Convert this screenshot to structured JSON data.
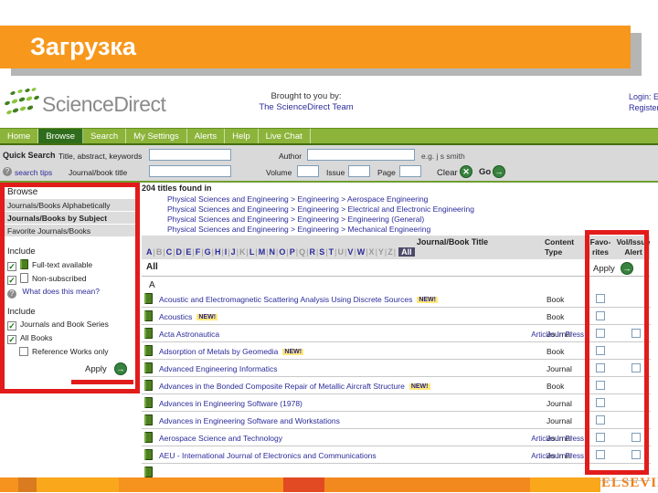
{
  "slide": {
    "title": "Загрузка"
  },
  "colors": {
    "accent_orange": "#F7981D",
    "nav_green": "#8CB43A",
    "active_tab_green": "#2F6D1C",
    "annotation_red": "#E21B1B",
    "link_blue": "#2B2B9B",
    "elsevier_orange": "#EF7F1A"
  },
  "header": {
    "logo_text": "ScienceDirect",
    "brought_line1": "Brought to you by:",
    "brought_line2": "The ScienceDirect Team",
    "login": "Login: E",
    "register": "Register"
  },
  "nav": {
    "items": [
      {
        "label": "Home",
        "active": false
      },
      {
        "label": "Browse",
        "active": true
      },
      {
        "label": "Search",
        "active": false
      },
      {
        "label": "My Settings",
        "active": false
      },
      {
        "label": "Alerts",
        "active": false
      },
      {
        "label": "Help",
        "active": false
      },
      {
        "label": "Live Chat",
        "active": false
      }
    ]
  },
  "quick_search": {
    "title": "Quick Search",
    "field1_label": "Title, abstract, keywords",
    "author_label": "Author",
    "hint": "e.g. j s smith",
    "tips_label": "search tips",
    "journal_label": "Journal/book title",
    "volume_label": "Volume",
    "issue_label": "Issue",
    "page_label": "Page",
    "clear_label": "Clear",
    "go_label": "Go"
  },
  "sidebar": {
    "header": "Browse",
    "items": [
      {
        "label": "Journals/Books Alphabetically",
        "selected": false
      },
      {
        "label": "Journals/Books by Subject",
        "selected": true
      },
      {
        "label": "Favorite Journals/Books",
        "selected": false
      }
    ],
    "include_content": {
      "label": "Include",
      "options": [
        {
          "label": "Full-text available",
          "checked": true,
          "icon": "subscribed-book-icon"
        },
        {
          "label": "Non-subscribed",
          "checked": true,
          "icon": "non-subscribed-book-icon"
        }
      ],
      "help": "What does this mean?"
    },
    "include_types": {
      "label": "Include",
      "options": [
        {
          "label": "Journals and Book Series",
          "checked": true,
          "indent": false
        },
        {
          "label": "All Books",
          "checked": true,
          "indent": false
        },
        {
          "label": "Reference Works only",
          "checked": false,
          "indent": true
        }
      ],
      "apply_label": "Apply"
    }
  },
  "results": {
    "found": "204 titles found in",
    "categories": [
      "Physical Sciences and Engineering > Engineering > Aerospace Engineering",
      "Physical Sciences and Engineering > Engineering > Electrical and Electronic Engineering",
      "Physical Sciences and Engineering > Engineering > Engineering (General)",
      "Physical Sciences and Engineering > Engineering > Mechanical Engineering"
    ],
    "columns": {
      "title": "Journal/Book Title",
      "content_line1": "Content",
      "content_line2": "Type",
      "fav_line1": "Favo-",
      "fav_line2": "rites",
      "alert_line1": "Vol/Issue",
      "alert_line2": "Alert"
    },
    "alphabet": [
      {
        "letter": "A",
        "state": "active"
      },
      {
        "letter": "B",
        "state": "inactive"
      },
      {
        "letter": "C",
        "state": "active"
      },
      {
        "letter": "D",
        "state": "active"
      },
      {
        "letter": "E",
        "state": "active"
      },
      {
        "letter": "F",
        "state": "active"
      },
      {
        "letter": "G",
        "state": "active"
      },
      {
        "letter": "H",
        "state": "active"
      },
      {
        "letter": "I",
        "state": "active"
      },
      {
        "letter": "J",
        "state": "active"
      },
      {
        "letter": "K",
        "state": "inactive"
      },
      {
        "letter": "L",
        "state": "active"
      },
      {
        "letter": "M",
        "state": "active"
      },
      {
        "letter": "N",
        "state": "active"
      },
      {
        "letter": "O",
        "state": "active"
      },
      {
        "letter": "P",
        "state": "active"
      },
      {
        "letter": "Q",
        "state": "inactive"
      },
      {
        "letter": "R",
        "state": "active"
      },
      {
        "letter": "S",
        "state": "active"
      },
      {
        "letter": "T",
        "state": "active"
      },
      {
        "letter": "U",
        "state": "inactive"
      },
      {
        "letter": "V",
        "state": "active"
      },
      {
        "letter": "W",
        "state": "active"
      },
      {
        "letter": "X",
        "state": "inactive"
      },
      {
        "letter": "Y",
        "state": "inactive"
      },
      {
        "letter": "Z",
        "state": "inactive"
      },
      {
        "letter": "All",
        "state": "selected"
      }
    ],
    "filter_label": "All",
    "apply_label": "Apply",
    "section": "A",
    "new_badge": "NEW!",
    "articles_in_press": "Articles In Press",
    "rows": [
      {
        "title": "Acoustic and Electromagnetic Scattering Analysis Using Discrete Sources",
        "new": true,
        "type": "Book",
        "aip": false,
        "fav": true,
        "alert": false
      },
      {
        "title": "Acoustics",
        "new": true,
        "type": "Book",
        "aip": false,
        "fav": true,
        "alert": false
      },
      {
        "title": "Acta Astronautica",
        "new": false,
        "type": "Journal",
        "aip": true,
        "fav": true,
        "alert": true
      },
      {
        "title": "Adsorption of Metals by Geomedia",
        "new": true,
        "type": "Book",
        "aip": false,
        "fav": true,
        "alert": false
      },
      {
        "title": "Advanced Engineering Informatics",
        "new": false,
        "type": "Journal",
        "aip": false,
        "fav": true,
        "alert": true
      },
      {
        "title": "Advances in the Bonded Composite Repair of Metallic Aircraft Structure",
        "new": true,
        "type": "Book",
        "aip": false,
        "fav": true,
        "alert": false
      },
      {
        "title": "Advances in Engineering Software (1978)",
        "new": false,
        "type": "Journal",
        "aip": false,
        "fav": true,
        "alert": false
      },
      {
        "title": "Advances in Engineering Software and Workstations",
        "new": false,
        "type": "Journal",
        "aip": false,
        "fav": true,
        "alert": false
      },
      {
        "title": "Aerospace Science and Technology",
        "new": false,
        "type": "Journal",
        "aip": true,
        "fav": true,
        "alert": true
      },
      {
        "title": "AEU - International Journal of Electronics and Communications",
        "new": false,
        "type": "Journal",
        "aip": true,
        "fav": true,
        "alert": true
      }
    ],
    "partial_row": true
  },
  "footer": {
    "brand": "ELSEVIER"
  }
}
